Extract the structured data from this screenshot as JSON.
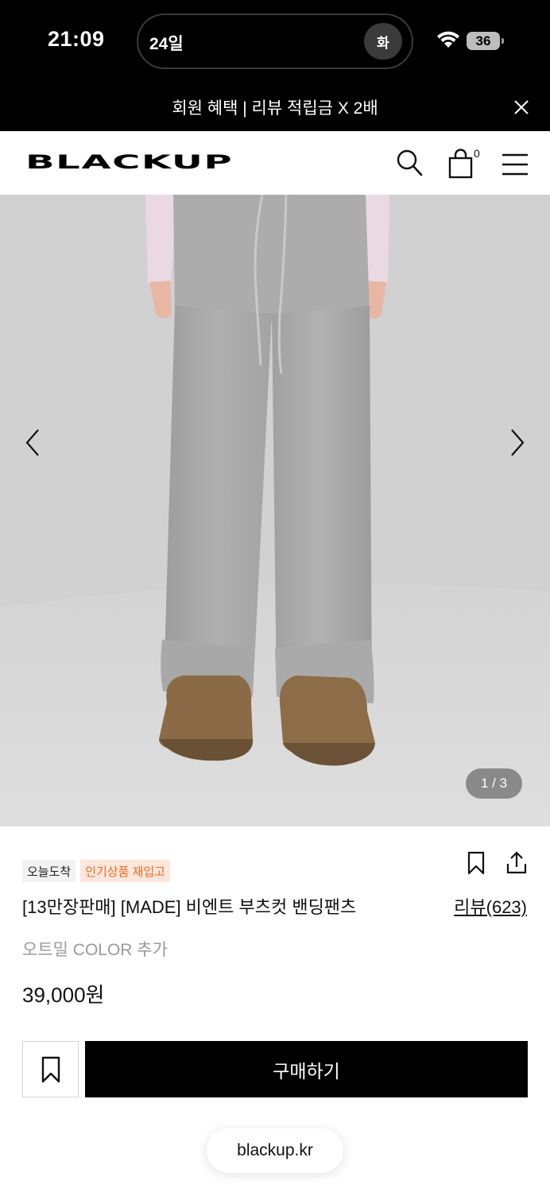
{
  "status_bar": {
    "time": "21:09",
    "date": "24일",
    "day": "화",
    "battery": "36"
  },
  "promo": {
    "text": "회원 혜택 | 리뷰 적립금 X 2배"
  },
  "header": {
    "logo": "BLACKUP",
    "cart_count": "0"
  },
  "gallery": {
    "counter": "1 / 3"
  },
  "product": {
    "badges": [
      "오늘도착",
      "인기상품 재입고"
    ],
    "title": "[13만장판매] [MADE] 비엔트 부츠컷 밴딩팬츠",
    "review_link": "리뷰(623)",
    "color_note": "오트밀 COLOR 추가",
    "price": "39,000원"
  },
  "actions": {
    "buy_label": "구매하기"
  },
  "browser": {
    "url": "blackup.kr"
  },
  "colors": {
    "accent_orange": "#f06a1f",
    "pants_gray": "#a7a7a7",
    "boot_brown": "#8a6a45"
  }
}
